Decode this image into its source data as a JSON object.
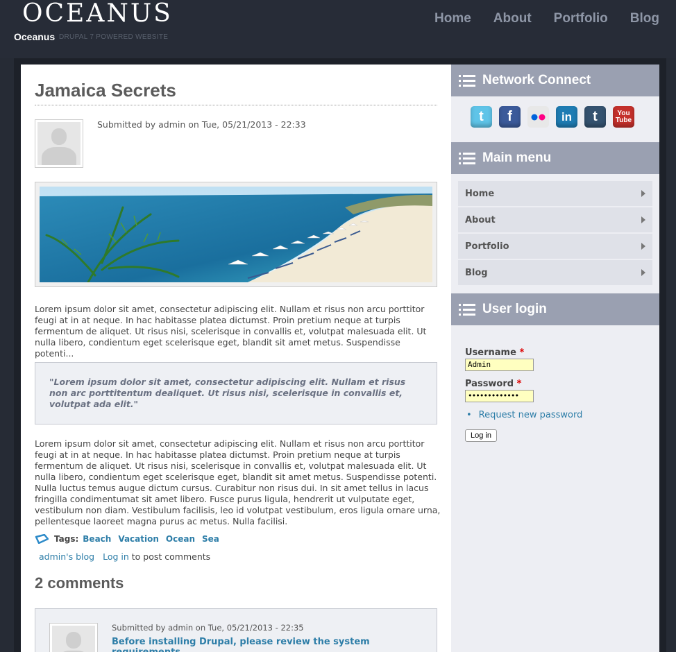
{
  "site": {
    "logo": "OCEANUS",
    "name": "Oceanus",
    "slogan": "DRUPAL 7 POWERED WEBSITE"
  },
  "nav": [
    "Home",
    "About",
    "Portfolio",
    "Blog"
  ],
  "article": {
    "title": "Jamaica Secrets",
    "submitted": "Submitted by admin on Tue, 05/21/2013 - 22:33",
    "intro": "Lorem ipsum dolor sit amet, consectetur adipiscing elit. Nullam et risus non arcu porttitor feugi at in at neque. In hac habitasse platea dictumst. Proin pretium neque at turpis fermentum de aliquet. Ut risus nisi, scelerisque in convallis et, volutpat malesuada elit. Ut nulla libero, condientum eget scelerisque eget, blandit sit amet metus. Suspendisse potenti...",
    "quote": "\"Lorem ipsum dolor sit amet, consectetur adipiscing elit. Nullam et risus non arc porttitentum dealiquet. Ut risus nisi, scelerisque in convallis et, volutpat ada elit.\"",
    "body": "Lorem ipsum dolor sit amet, consectetur adipiscing elit. Nullam et risus non arcu porttitor feugi at in at neque. In hac habitasse platea dictumst. Proin pretium neque at turpis fermentum de aliquet. Ut risus nisi, scelerisque in convallis et, volutpat malesuada elit. Ut nulla libero, condientum eget scelerisque eget, blandit sit amet metus. Suspendisse potenti. Nulla luctus temus augue dictum cursus. Curabitur non risus dui. In sit amet tellus in lacus fringilla condimentumat sit amet libero. Fusce purus ligula, hendrerit ut vulputate eget, vestibulum non diam. Vestibulum facilisis, leo id volutpat vestibulum, eros ligula ornare urna, pellentesque laoreet magna purus ac metus. Nulla facilisi.",
    "tags_label": "Tags:",
    "tags": [
      "Beach",
      "Vacation",
      "Ocean",
      "Sea"
    ],
    "blog_link": "admin's blog",
    "login_link": "Log in",
    "login_suffix": "to post comments",
    "comments_heading": "2 comments",
    "comment": {
      "submitted": "Submitted by admin on Tue, 05/21/2013 - 22:35",
      "title": "Before installing Drupal, please review the system requirements"
    }
  },
  "sidebar": {
    "network_title": "Network Connect",
    "social": [
      "twitter-icon",
      "facebook-icon",
      "flickr-icon",
      "linkedin-icon",
      "tumblr-icon",
      "youtube-icon"
    ],
    "menu_title": "Main menu",
    "menu": [
      "Home",
      "About",
      "Portfolio",
      "Blog"
    ],
    "login_title": "User login",
    "username_label": "Username",
    "username_value": "Admin",
    "password_label": "Password",
    "password_value": "•••••••••••••",
    "request_password": "Request new password",
    "login_button": "Log in"
  },
  "colors": {
    "link": "#2e7ea8",
    "block_header": "#9aa0b1",
    "background": "#262b35"
  }
}
